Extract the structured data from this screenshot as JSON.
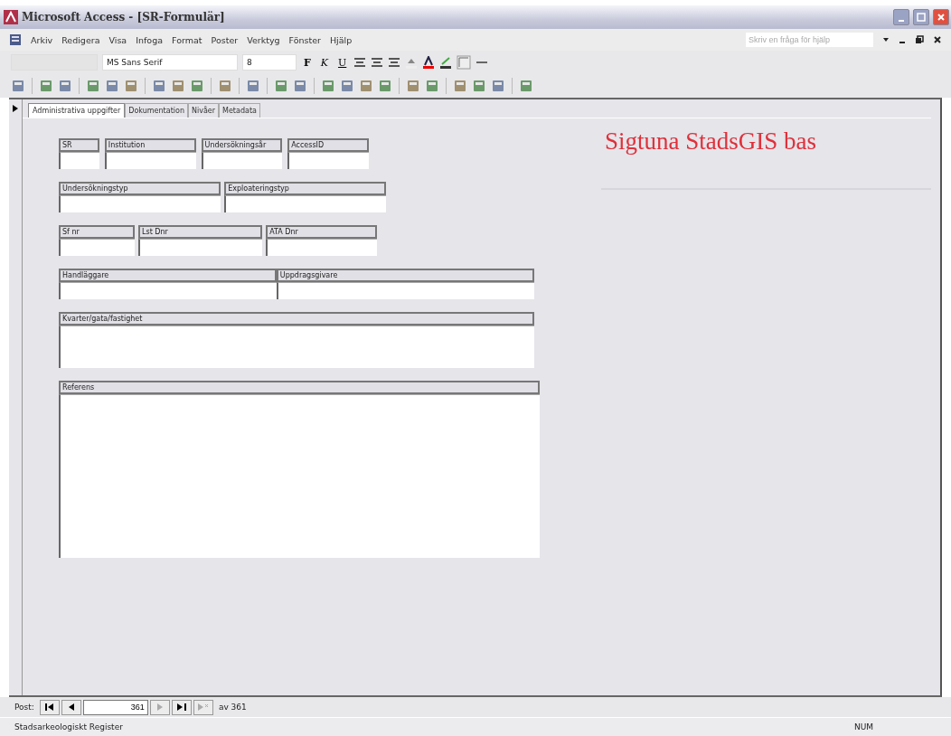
{
  "window": {
    "title": "Microsoft Access - [SR-Formulär]"
  },
  "menu": [
    {
      "label": "Arkiv"
    },
    {
      "label": "Redigera"
    },
    {
      "label": "Visa"
    },
    {
      "label": "Infoga"
    },
    {
      "label": "Format"
    },
    {
      "label": "Poster"
    },
    {
      "label": "Verktyg"
    },
    {
      "label": "Fönster"
    },
    {
      "label": "Hjälp"
    }
  ],
  "help_box": {
    "placeholder": "Skriv en fråga för hjälp"
  },
  "format_toolbar": {
    "font": "MS Sans Serif",
    "size": "8",
    "style_buttons": [
      "F",
      "K",
      "U"
    ]
  },
  "tabs": [
    {
      "label": "Administrativa uppgifter",
      "selected": true
    },
    {
      "label": "Dokumentation",
      "selected": false
    },
    {
      "label": "Nivåer",
      "selected": false
    },
    {
      "label": "Metadata",
      "selected": false
    }
  ],
  "form_title": "Sigtuna StadsGIS bas",
  "field_rows": [
    {
      "fields": [
        {
          "label": "SR",
          "kind": "line"
        },
        {
          "label": "Institution",
          "kind": "line"
        },
        {
          "label": "Undersökningsår",
          "kind": "line"
        },
        {
          "label": "AccessID",
          "kind": "line"
        }
      ]
    },
    {
      "fields": [
        {
          "label": "Undersökningstyp",
          "kind": "line"
        },
        {
          "label": "Exploateringstyp",
          "kind": "line"
        }
      ]
    },
    {
      "fields": [
        {
          "label": "Sf nr",
          "kind": "line"
        },
        {
          "label": "Lst Dnr",
          "kind": "line"
        },
        {
          "label": "ATA Dnr",
          "kind": "line"
        }
      ]
    },
    {
      "fields": [
        {
          "label": "Handläggare",
          "kind": "line"
        },
        {
          "label": "Uppdragsgivare",
          "kind": "line"
        }
      ]
    },
    {
      "fields": [
        {
          "label": "Kvarter/gata/fastighet",
          "kind": "memo"
        }
      ]
    },
    {
      "fields": [
        {
          "label": "Referens",
          "kind": "memo"
        }
      ]
    }
  ],
  "navigation": {
    "label": "Post:",
    "current": "361",
    "total": "av 361"
  },
  "status_bar": {
    "text": "Stadsarkeologiskt Register",
    "indicator": "NUM"
  }
}
